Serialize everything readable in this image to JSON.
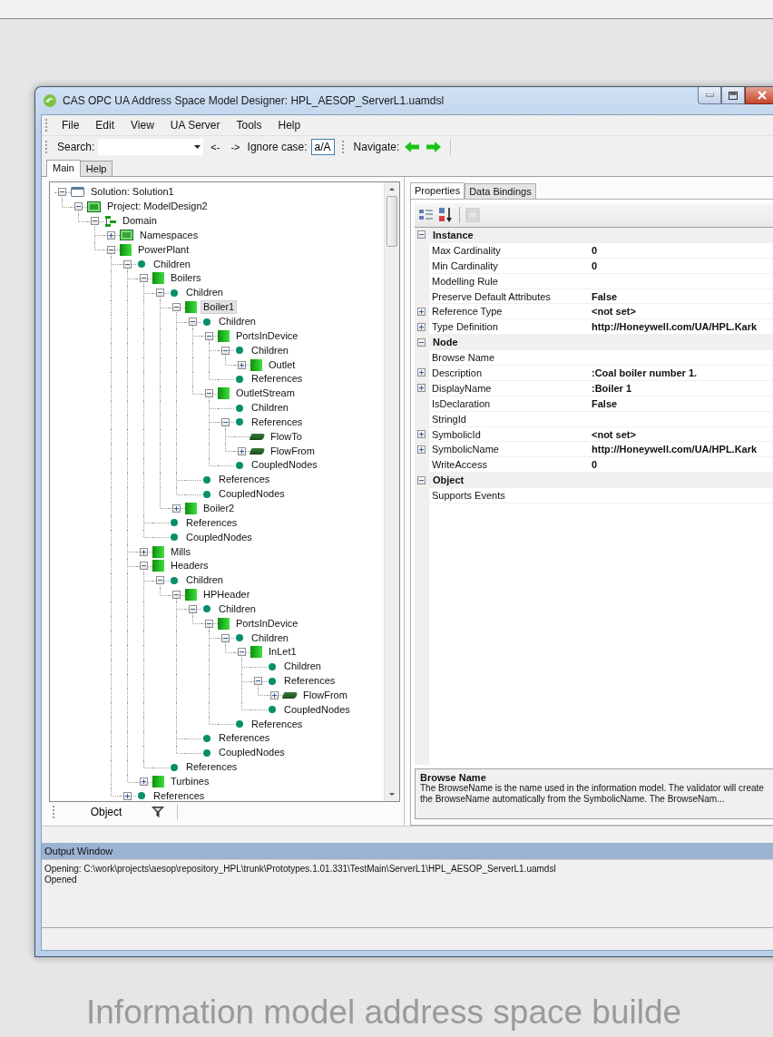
{
  "window": {
    "title": "CAS OPC UA Address Space Model Designer: HPL_AESOP_ServerL1.uamdsl"
  },
  "menu": [
    "File",
    "Edit",
    "View",
    "UA Server",
    "Tools",
    "Help"
  ],
  "toolbar": {
    "search_label": "Search:",
    "back": "<-",
    "forward": "->",
    "ignore_case_label": "Ignore case:",
    "ignore_case_button": "a/A",
    "navigate_label": "Navigate:"
  },
  "tabs": [
    {
      "label": "Main",
      "selected": true
    },
    {
      "label": "Help",
      "selected": false
    }
  ],
  "tree": {
    "label": "Solution: Solution1",
    "kind": "solution",
    "selected": false,
    "expanded": true,
    "children": [
      {
        "label": "Project: ModelDesign2",
        "kind": "project",
        "selected": false,
        "expanded": true,
        "children": [
          {
            "label": "Domain",
            "kind": "domain",
            "selected": false,
            "expanded": true,
            "children": [
              {
                "label": "Namespaces",
                "kind": "namespaces",
                "selected": false,
                "expanded": false
              },
              {
                "label": "PowerPlant",
                "kind": "object",
                "selected": false,
                "expanded": true,
                "children": [
                  {
                    "label": "Children",
                    "kind": "folder",
                    "selected": false,
                    "expanded": true,
                    "children": [
                      {
                        "label": "Boilers",
                        "kind": "object",
                        "selected": false,
                        "expanded": true,
                        "children": [
                          {
                            "label": "Children",
                            "kind": "folder",
                            "selected": false,
                            "expanded": true,
                            "children": [
                              {
                                "label": "Boiler1",
                                "kind": "object",
                                "selected": true,
                                "expanded": true,
                                "children": [
                                  {
                                    "label": "Children",
                                    "kind": "folder",
                                    "selected": false,
                                    "expanded": true,
                                    "children": [
                                      {
                                        "label": "PortsInDevice",
                                        "kind": "object",
                                        "selected": false,
                                        "expanded": true,
                                        "children": [
                                          {
                                            "label": "Children",
                                            "kind": "folder",
                                            "selected": false,
                                            "expanded": true,
                                            "children": [
                                              {
                                                "label": "Outlet",
                                                "kind": "object",
                                                "selected": false,
                                                "expanded": false
                                              }
                                            ]
                                          },
                                          {
                                            "label": "References",
                                            "kind": "folder",
                                            "selected": false
                                          }
                                        ]
                                      },
                                      {
                                        "label": "OutletStream",
                                        "kind": "object",
                                        "selected": false,
                                        "expanded": true,
                                        "children": [
                                          {
                                            "label": "Children",
                                            "kind": "folder",
                                            "selected": false
                                          },
                                          {
                                            "label": "References",
                                            "kind": "folder",
                                            "selected": false,
                                            "expanded": true,
                                            "children": [
                                              {
                                                "label": "FlowTo",
                                                "kind": "reference",
                                                "selected": false
                                              },
                                              {
                                                "label": "FlowFrom",
                                                "kind": "reference",
                                                "selected": false,
                                                "expanded": false
                                              }
                                            ]
                                          },
                                          {
                                            "label": "CoupledNodes",
                                            "kind": "folder",
                                            "selected": false
                                          }
                                        ]
                                      }
                                    ]
                                  },
                                  {
                                    "label": "References",
                                    "kind": "folder",
                                    "selected": false
                                  },
                                  {
                                    "label": "CoupledNodes",
                                    "kind": "folder",
                                    "selected": false
                                  }
                                ]
                              },
                              {
                                "label": "Boiler2",
                                "kind": "object",
                                "selected": false,
                                "expanded": false
                              }
                            ]
                          },
                          {
                            "label": "References",
                            "kind": "folder",
                            "selected": false
                          },
                          {
                            "label": "CoupledNodes",
                            "kind": "folder",
                            "selected": false
                          }
                        ]
                      },
                      {
                        "label": "Mills",
                        "kind": "object",
                        "selected": false,
                        "expanded": false
                      },
                      {
                        "label": "Headers",
                        "kind": "object",
                        "selected": false,
                        "expanded": true,
                        "children": [
                          {
                            "label": "Children",
                            "kind": "folder",
                            "selected": false,
                            "expanded": true,
                            "children": [
                              {
                                "label": "HPHeader",
                                "kind": "object",
                                "selected": false,
                                "expanded": true,
                                "children": [
                                  {
                                    "label": "Children",
                                    "kind": "folder",
                                    "selected": false,
                                    "expanded": true,
                                    "children": [
                                      {
                                        "label": "PortsInDevice",
                                        "kind": "object",
                                        "selected": false,
                                        "expanded": true,
                                        "children": [
                                          {
                                            "label": "Children",
                                            "kind": "folder",
                                            "selected": false,
                                            "expanded": true,
                                            "children": [
                                              {
                                                "label": "InLet1",
                                                "kind": "object",
                                                "selected": false,
                                                "expanded": true,
                                                "children": [
                                                  {
                                                    "label": "Children",
                                                    "kind": "folder",
                                                    "selected": false
                                                  },
                                                  {
                                                    "label": "References",
                                                    "kind": "folder",
                                                    "selected": false,
                                                    "expanded": true,
                                                    "children": [
                                                      {
                                                        "label": "FlowFrom",
                                                        "kind": "reference",
                                                        "selected": false,
                                                        "expanded": false
                                                      }
                                                    ]
                                                  },
                                                  {
                                                    "label": "CoupledNodes",
                                                    "kind": "folder",
                                                    "selected": false
                                                  }
                                                ]
                                              }
                                            ]
                                          },
                                          {
                                            "label": "References",
                                            "kind": "folder",
                                            "selected": false
                                          }
                                        ]
                                      }
                                    ]
                                  },
                                  {
                                    "label": "References",
                                    "kind": "folder",
                                    "selected": false
                                  },
                                  {
                                    "label": "CoupledNodes",
                                    "kind": "folder",
                                    "selected": false
                                  }
                                ]
                              }
                            ]
                          },
                          {
                            "label": "References",
                            "kind": "folder",
                            "selected": false
                          }
                        ]
                      },
                      {
                        "label": "Turbines",
                        "kind": "object",
                        "selected": false,
                        "expanded": false
                      }
                    ]
                  },
                  {
                    "label": "References",
                    "kind": "folder",
                    "selected": false,
                    "expanded": false
                  }
                ]
              }
            ]
          }
        ]
      }
    ]
  },
  "tree_toolbar": {
    "label": "Object"
  },
  "property_tabs": [
    {
      "label": "Properties",
      "selected": true
    },
    {
      "label": "Data Bindings",
      "selected": false
    }
  ],
  "properties": [
    {
      "category": "Instance",
      "expanded": true,
      "rows": [
        {
          "name": "Max Cardinality",
          "value": "0"
        },
        {
          "name": "Min Cardinality",
          "value": "0"
        },
        {
          "name": "Modelling Rule"
        },
        {
          "name": "Preserve Default Attributes",
          "value": "False"
        },
        {
          "name": "Reference Type",
          "value": "<not set>",
          "expanded": false
        },
        {
          "name": "Type Definition",
          "value": "http://Honeywell.com/UA/HPL.Kark",
          "expanded": false
        }
      ]
    },
    {
      "category": "Node",
      "expanded": true,
      "rows": [
        {
          "name": "Browse Name"
        },
        {
          "name": "Description",
          "value": ":Coal boiler number 1.",
          "expanded": false
        },
        {
          "name": "DisplayName",
          "value": ":Boiler 1",
          "expanded": false
        },
        {
          "name": "IsDeclaration",
          "value": "False"
        },
        {
          "name": "StringId"
        },
        {
          "name": "SymbolicId",
          "value": "<not set>",
          "expanded": false
        },
        {
          "name": "SymbolicName",
          "value": "http://Honeywell.com/UA/HPL.Kark",
          "expanded": false
        },
        {
          "name": "WriteAccess",
          "value": "0"
        }
      ]
    },
    {
      "category": "Object",
      "expanded": true,
      "rows": [
        {
          "name": "Supports Events"
        }
      ]
    }
  ],
  "help": {
    "title": "Browse Name",
    "text": "The BrowseName is the name used in the information model. The validator will create the BrowseName automatically from the SymbolicName. The BrowseNam..."
  },
  "output": {
    "title": "Output Window",
    "lines": [
      "Opening: C:\\work\\projects\\aesop\\repository_HPL\\trunk\\Prototypes.1.01.331\\TestMain\\ServerL1\\HPL_AESOP_ServerL1.uamdsl",
      "Opened"
    ]
  },
  "caption": "Information model address space builde"
}
